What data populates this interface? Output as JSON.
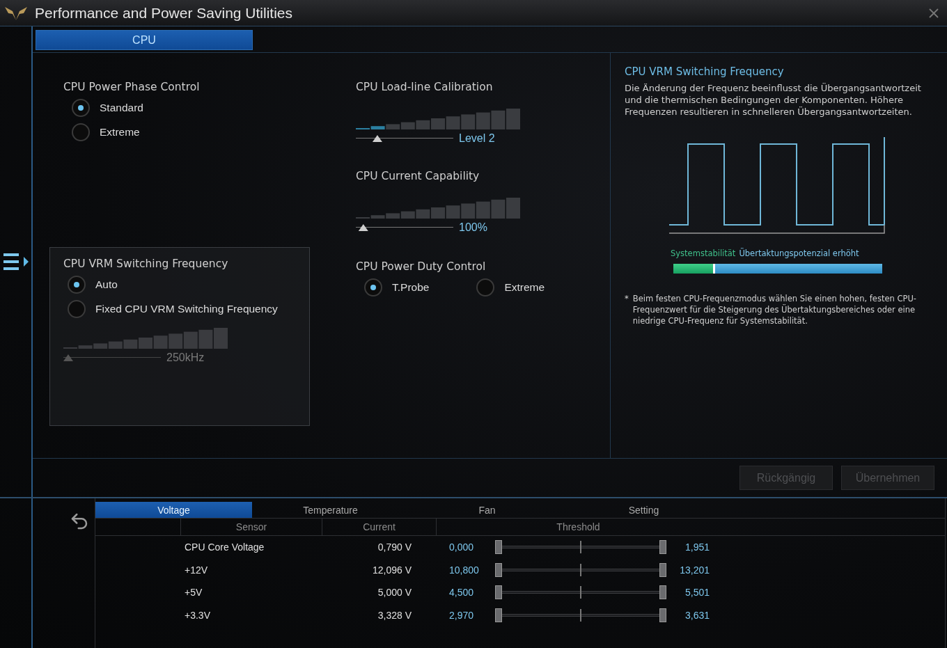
{
  "window": {
    "title": "Performance and Power Saving Utilities"
  },
  "tabs": [
    {
      "label": "CPU",
      "selected": true
    }
  ],
  "phase_control": {
    "title": "CPU Power Phase Control",
    "options": [
      {
        "label": "Standard",
        "selected": true
      },
      {
        "label": "Extreme",
        "selected": false
      }
    ]
  },
  "vrm_frequency": {
    "title": "CPU VRM Switching Frequency",
    "options": [
      {
        "label": "Auto",
        "selected": true
      },
      {
        "label": "Fixed CPU VRM Switching Frequency",
        "selected": false
      }
    ],
    "slider": {
      "level": 0,
      "reading": "250kHz",
      "disabled": true
    }
  },
  "load_line": {
    "title": "CPU Load-line Calibration",
    "slider": {
      "level": 0.19,
      "reading": "Level 2",
      "disabled": false
    }
  },
  "current_capability": {
    "title": "CPU Current Capability",
    "slider": {
      "level": 0.03,
      "reading": "100%",
      "disabled": false
    }
  },
  "duty_control": {
    "title": "CPU Power Duty Control",
    "options": [
      {
        "label": "T.Probe",
        "selected": true
      },
      {
        "label": "Extreme",
        "selected": false
      }
    ]
  },
  "info": {
    "title": "CPU VRM Switching Frequency",
    "text": "Die Änderung der Frequenz beeinflusst die Übergangsantwortzeit und die thermischen Bedingungen der Komponenten. Höhere Frequenzen resultieren in schnelleren Übergangsantwortzeiten.",
    "legend_left": "Systemstabilität",
    "legend_right": "Übertaktungspotenzial erhöht",
    "balance": {
      "level": 0.2
    },
    "note_mark": "*",
    "note": "Beim festen CPU-Frequenzmodus wählen Sie einen hohen, festen CPU-Frequenzwert für die Steigerung des Übertaktungsbereiches oder eine niedrige CPU-Frequenz für Systemstabilität."
  },
  "buttons": [
    {
      "label": "Rückgängig",
      "disabled": true
    },
    {
      "label": "Übernehmen",
      "disabled": true
    }
  ],
  "monitor": {
    "tabs": [
      {
        "label": "Voltage",
        "selected": true
      },
      {
        "label": "Temperature",
        "selected": false
      },
      {
        "label": "Fan",
        "selected": false
      },
      {
        "label": "Setting",
        "selected": false
      }
    ],
    "columns": [
      "Sensor",
      "Current",
      "Threshold"
    ],
    "rows": [
      {
        "sensor": "CPU Core Voltage",
        "current": "0,790 V",
        "low": "0,000",
        "high": "1,951",
        "low_handle": {
          "level": 0
        },
        "high_handle": {
          "level": 1
        }
      },
      {
        "sensor": "+12V",
        "current": "12,096 V",
        "low": "10,800",
        "high": "13,201",
        "low_handle": {
          "level": 0
        },
        "high_handle": {
          "level": 1
        }
      },
      {
        "sensor": "+5V",
        "current": "5,000 V",
        "low": "4,500",
        "high": "5,501",
        "low_handle": {
          "level": 0
        },
        "high_handle": {
          "level": 1
        }
      },
      {
        "sensor": "+3.3V",
        "current": "3,328 V",
        "low": "2,970",
        "high": "3,631",
        "low_handle": {
          "level": 0
        },
        "high_handle": {
          "level": 1
        }
      }
    ]
  }
}
